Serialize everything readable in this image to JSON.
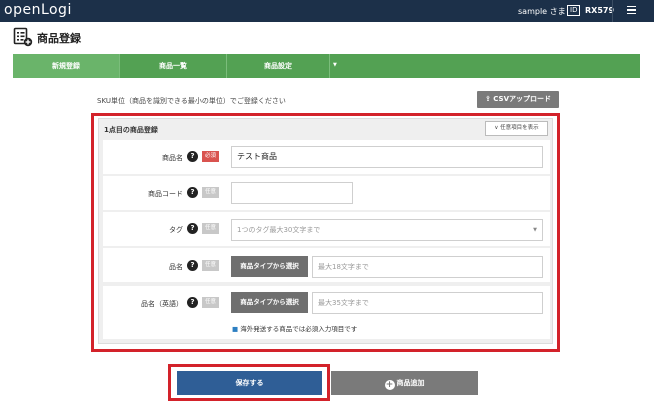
{
  "header": {
    "logo": "openLogi",
    "user": "sample さま",
    "id_badge": "ID",
    "user_id": "RX579",
    "menu_icon": "hamburger-icon"
  },
  "page": {
    "title": "商品登録",
    "title_icon": "product-list-add-icon"
  },
  "tabs": [
    {
      "label": "新規登録",
      "active": true
    },
    {
      "label": "商品一覧",
      "active": false
    },
    {
      "label": "商品設定",
      "active": false,
      "dropdown_icon": "caret-down-icon"
    }
  ],
  "hint": "SKU単位（商品を識別できる最小の単位）でご登録ください",
  "csv_button": {
    "label": "CSVアップロード",
    "icon": "upload-icon"
  },
  "form": {
    "title": "1点目の商品登録",
    "optional_toggle": "任意項目を表示",
    "rows": [
      {
        "label": "商品名",
        "badge": "必須",
        "required": true,
        "value": "テスト商品"
      },
      {
        "label": "商品コード",
        "badge": "任意",
        "required": false,
        "value": ""
      },
      {
        "label": "タグ",
        "badge": "任意",
        "required": false,
        "placeholder": "1つのタグ最大30文字まで"
      },
      {
        "label": "品名",
        "badge": "任意",
        "required": false,
        "button": "商品タイプから選択",
        "placeholder": "最大18文字まで"
      },
      {
        "label": "品名（英語）",
        "badge": "任意",
        "required": false,
        "button": "商品タイプから選択",
        "placeholder": "最大35文字まで"
      }
    ],
    "note": "海外発送する商品では必須入力項目です"
  },
  "actions": {
    "save": "保存する",
    "add": "商品追加"
  },
  "colors": {
    "header": "#1c3049",
    "tabs": "#53a153",
    "required": "#d9534f",
    "save": "#2f5e96",
    "highlight": "#d3222a"
  }
}
